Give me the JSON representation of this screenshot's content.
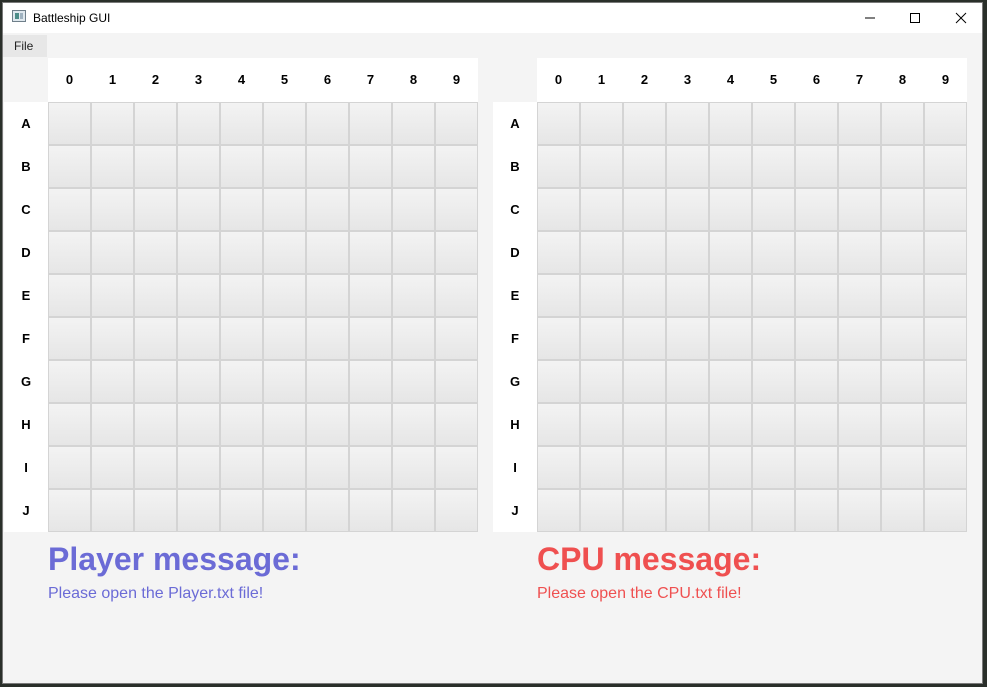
{
  "window": {
    "title": "Battleship GUI"
  },
  "menu": {
    "file_label": "File"
  },
  "columns": [
    "0",
    "1",
    "2",
    "3",
    "4",
    "5",
    "6",
    "7",
    "8",
    "9"
  ],
  "rows": [
    "A",
    "B",
    "C",
    "D",
    "E",
    "F",
    "G",
    "H",
    "I",
    "J"
  ],
  "player": {
    "message_title": "Player message:",
    "message_body": "Please open the Player.txt file!"
  },
  "cpu": {
    "message_title": "CPU message:",
    "message_body": "Please open the CPU.txt file!"
  },
  "colors": {
    "player": "#6b6bd6",
    "cpu": "#ef5050",
    "cell": "#ececec",
    "cell_border": "#d4d4d4"
  },
  "icons": {
    "app": "app-window-icon",
    "minimize": "minimize-icon",
    "maximize": "maximize-icon",
    "close": "close-icon"
  }
}
